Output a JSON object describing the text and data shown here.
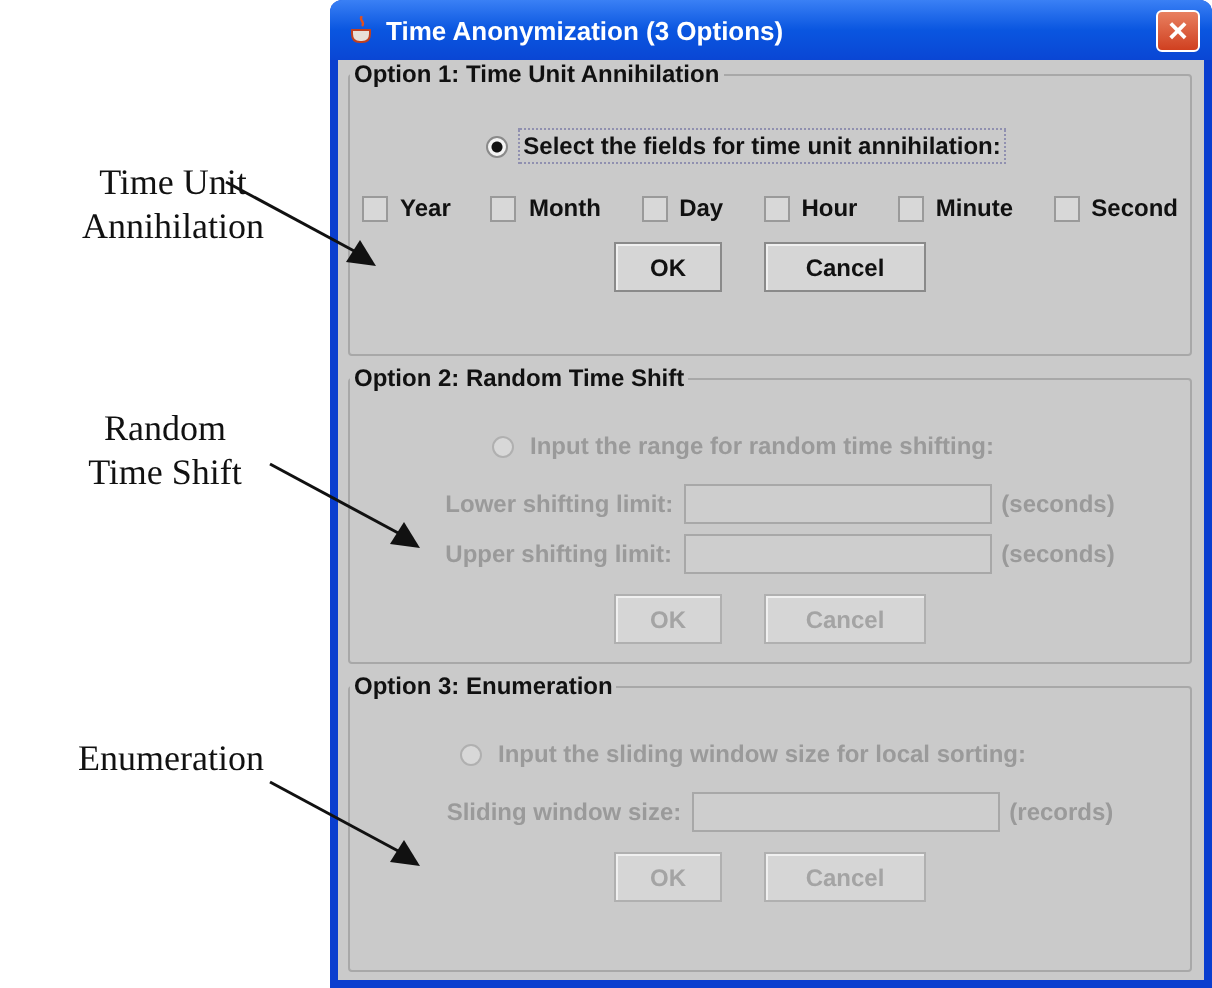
{
  "annotations": [
    {
      "lines": [
        "Time Unit",
        "Annihilation"
      ]
    },
    {
      "lines": [
        "Random",
        "Time Shift"
      ]
    },
    {
      "lines": [
        "Enumeration"
      ]
    }
  ],
  "window": {
    "title": "Time Anonymization (3 Options)",
    "close": "×"
  },
  "options": [
    {
      "title": "Option 1: Time Unit Annihilation",
      "enabled": true,
      "kind": "checkboxes",
      "radio": {
        "label": "Select the fields for time unit annihilation:",
        "selected": true
      },
      "checkboxes": [
        {
          "label": "Year",
          "checked": false
        },
        {
          "label": "Month",
          "checked": false
        },
        {
          "label": "Day",
          "checked": false
        },
        {
          "label": "Hour",
          "checked": false
        },
        {
          "label": "Minute",
          "checked": false
        },
        {
          "label": "Second",
          "checked": false
        }
      ],
      "buttons": [
        "OK",
        "Cancel"
      ]
    },
    {
      "title": "Option 2: Random Time Shift",
      "enabled": false,
      "kind": "fields",
      "radio": {
        "label": "Input the range for random time shifting:",
        "selected": false
      },
      "fields": [
        {
          "label": "Lower shifting limit:",
          "unit": "(seconds)"
        },
        {
          "label": "Upper shifting limit:",
          "unit": "(seconds)"
        }
      ],
      "buttons": [
        "OK",
        "Cancel"
      ]
    },
    {
      "title": "Option 3: Enumeration",
      "enabled": false,
      "kind": "fields",
      "radio": {
        "label": "Input the sliding window size for local sorting:",
        "selected": false
      },
      "fields": [
        {
          "label": "Sliding window size:",
          "unit": "(records)"
        }
      ],
      "buttons": [
        "OK",
        "Cancel"
      ]
    }
  ]
}
